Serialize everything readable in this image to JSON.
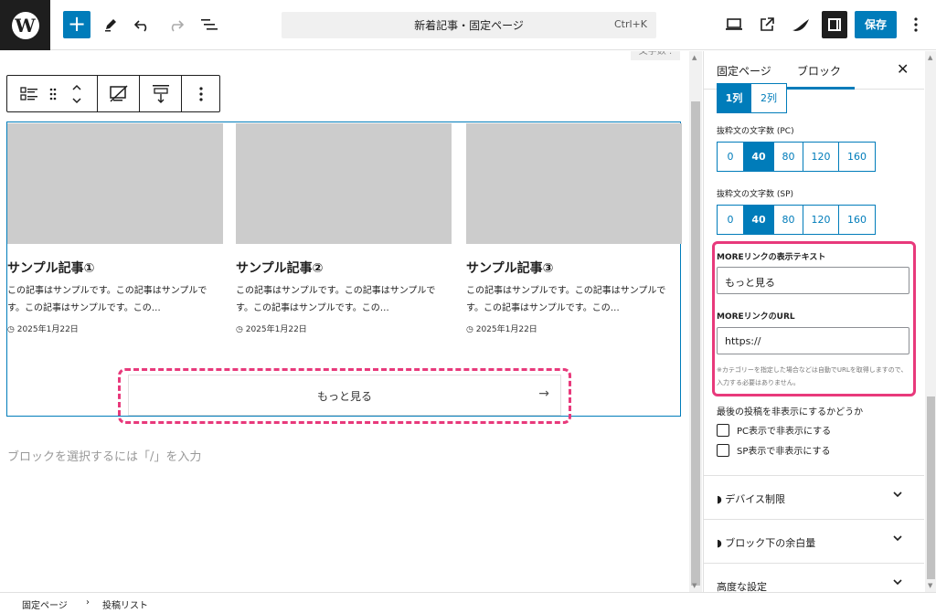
{
  "topbar": {
    "doc_title": "新着記事・固定ページ",
    "shortcut": "Ctrl+K",
    "add_label": "+",
    "save_label": "保存"
  },
  "toolbar_icons": [
    "plus-icon",
    "pencil-icon",
    "undo-icon",
    "redo-icon",
    "list-view-icon",
    "desktop-preview-icon",
    "external-link-icon",
    "swell-logo-icon",
    "settings-panel-icon",
    "more-vertical-icon"
  ],
  "canvas": {
    "char_count_tag": "文字数 :",
    "cards": [
      {
        "title": "サンプル記事①",
        "excerpt": "この記事はサンプルです。この記事はサンプルです。この記事はサンプルです。この…",
        "date": "2025年1月22日"
      },
      {
        "title": "サンプル記事②",
        "excerpt": "この記事はサンプルです。この記事はサンプルです。この記事はサンプルです。この…",
        "date": "2025年1月22日"
      },
      {
        "title": "サンプル記事③",
        "excerpt": "この記事はサンプルです。この記事はサンプルです。この記事はサンプルです。この…",
        "date": "2025年1月22日"
      }
    ],
    "more_button_label": "もっと見る",
    "more_button_arrow": "→",
    "block_placeholder": "ブロックを選択するには「/」を入力"
  },
  "sidebar": {
    "tabs": [
      {
        "label": "固定ページ",
        "active": false
      },
      {
        "label": "ブロック",
        "active": true
      }
    ],
    "close_label": "✕",
    "columns_options": [
      "1列",
      "2列"
    ],
    "columns_selected": "1列",
    "excerpt_pc_label": "抜粋文の文字数 (PC)",
    "excerpt_pc_options": [
      "0",
      "40",
      "80",
      "120",
      "160"
    ],
    "excerpt_pc_selected": "40",
    "excerpt_sp_label": "抜粋文の文字数 (SP)",
    "excerpt_sp_options": [
      "0",
      "40",
      "80",
      "120",
      "160"
    ],
    "excerpt_sp_selected": "40",
    "more_text_label": "MOREリンクの表示テキスト",
    "more_text_value": "もっと見る",
    "more_url_label": "MOREリンクのURL",
    "more_url_value": "https://",
    "more_help": "※カテゴリーを指定した場合などは自動でURLを取得しますので、入力する必要はありません。",
    "hide_last_label": "最後の投稿を非表示にするかどうか",
    "hide_pc_label": "PC表示で非表示にする",
    "hide_sp_label": "SP表示で非表示にする",
    "panels": [
      {
        "label": "デバイス制限"
      },
      {
        "label": "ブロック下の余白量"
      },
      {
        "label": "高度な設定"
      }
    ]
  },
  "footer": {
    "breadcrumb": [
      "固定ページ",
      "投稿リスト"
    ],
    "separator": "›"
  },
  "colors": {
    "accent": "#007cba",
    "highlight": "#e8397b",
    "thumb_placeholder": "#cccccc",
    "dark": "#1e1e1e"
  }
}
